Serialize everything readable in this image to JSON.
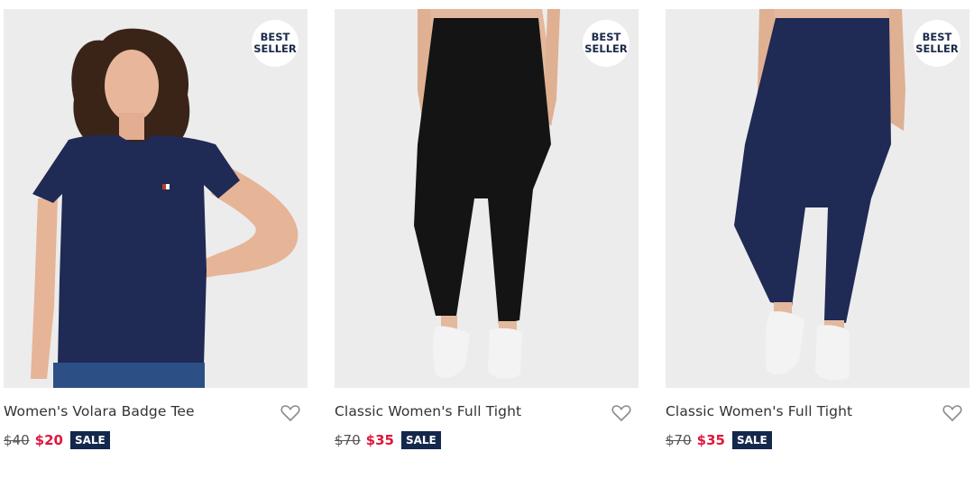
{
  "colors": {
    "image_bg": "#ececec",
    "sale_price": "#e0173c",
    "sale_tag_bg": "#13284c",
    "navy": "#1f2a55"
  },
  "products": [
    {
      "badge_line1": "BEST",
      "badge_line2": "SELLER",
      "title": "Women's Volara Badge Tee",
      "old_price": "$40",
      "new_price": "$20",
      "sale_label": "SALE",
      "icon": "heart-icon"
    },
    {
      "badge_line1": "BEST",
      "badge_line2": "SELLER",
      "title": "Classic Women's Full Tight",
      "old_price": "$70",
      "new_price": "$35",
      "sale_label": "SALE",
      "icon": "heart-icon"
    },
    {
      "badge_line1": "BEST",
      "badge_line2": "SELLER",
      "title": "Classic Women's Full Tight",
      "old_price": "$70",
      "new_price": "$35",
      "sale_label": "SALE",
      "icon": "heart-icon"
    }
  ]
}
